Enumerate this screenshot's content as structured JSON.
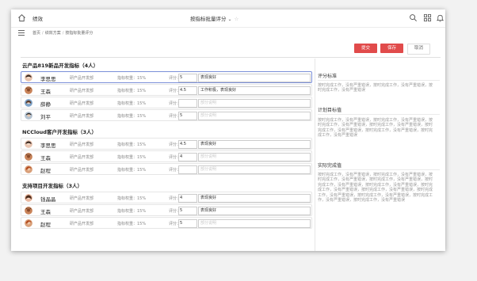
{
  "header": {
    "app_title": "绩效",
    "page_title": "按指标批量评分"
  },
  "breadcrumb": {
    "items": [
      "首页",
      "绩效方案",
      "按指标批量评分"
    ]
  },
  "actions": {
    "submit": "提交",
    "save": "保存",
    "cancel": "取消"
  },
  "groups": [
    {
      "title": "云产品819新品开发指标（4人）",
      "rows": [
        {
          "name": "李思思",
          "dept": "研产品开发部",
          "weight": "指标权重：15%",
          "score_label": "评分：",
          "score": "5",
          "comment": "表现良好",
          "comment_placeholder": ""
        },
        {
          "name": "王森",
          "dept": "研产品开发部",
          "weight": "指标权重：15%",
          "score_label": "评分：",
          "score": "4.5",
          "comment": "工作积极，表现良好",
          "comment_placeholder": ""
        },
        {
          "name": "薛静",
          "dept": "研产品开发部",
          "weight": "指标权重：15%",
          "score_label": "评分：",
          "score": "",
          "comment": "",
          "comment_placeholder": "部分说明"
        },
        {
          "name": "刘平",
          "dept": "研产品开发部",
          "weight": "指标权重：15%",
          "score_label": "评分：",
          "score": "5",
          "comment": "",
          "comment_placeholder": "部分说明"
        }
      ]
    },
    {
      "title": "NCCloud客户开发指标（3人）",
      "rows": [
        {
          "name": "李思思",
          "dept": "研产品开发部",
          "weight": "指标权重：15%",
          "score_label": "评分：",
          "score": "4.5",
          "comment": "表现良好",
          "comment_placeholder": ""
        },
        {
          "name": "王森",
          "dept": "研产品开发部",
          "weight": "指标权重：15%",
          "score_label": "评分：",
          "score": "4",
          "comment": "",
          "comment_placeholder": "部分说明"
        },
        {
          "name": "赵程",
          "dept": "研产品开发部",
          "weight": "指标权重：15%",
          "score_label": "评分：",
          "score": "",
          "comment": "",
          "comment_placeholder": "部分说明"
        }
      ]
    },
    {
      "title": "支持项目开发指标（3人）",
      "rows": [
        {
          "name": "钱晶晶",
          "dept": "研产品开发部",
          "weight": "指标权重：15%",
          "score_label": "评分：",
          "score": "4",
          "comment": "表现良好",
          "comment_placeholder": ""
        },
        {
          "name": "王森",
          "dept": "研产品开发部",
          "weight": "指标权重：15%",
          "score_label": "评分：",
          "score": "5",
          "comment": "表现良好",
          "comment_placeholder": ""
        },
        {
          "name": "赵程",
          "dept": "研产品开发部",
          "weight": "指标权重：15%",
          "score_label": "评分：",
          "score": "5",
          "comment": "",
          "comment_placeholder": "部分说明"
        }
      ]
    }
  ],
  "side": {
    "sections": [
      {
        "title": "评分标准",
        "body": "按时完成工作，没有严重错误，按时完成工作，没有严重错误，按时完成工作，没有严重错误"
      },
      {
        "title": "计划目标值",
        "body": "按时完成工作，没有严重错误，按时完成工作，没有严重错误，按时完成工作，没有严重错误，按时完成工作，没有严重错误，按时完成工作，没有严重错误，按时完成工作，没有严重错误，按时完成工作，没有严重错误"
      },
      {
        "title": "实际完成值",
        "body": "按时完成工作，没有严重错误，按时完成工作，没有严重错误，按时完成工作，没有严重错误，按时完成工作，没有严重错误，按时完成工作，没有严重错误，按时完成工作，没有严重错误，按时完成工作，没有严重错误，按时完成工作，没有严重错误，按时完成工作，没有严重错误，按时完成工作，没有严重错误，按时完成工作，没有严重错误，按时完成工作，没有严重错误"
      }
    ]
  },
  "colors": {
    "accent_red": "#e14b4b",
    "active_row_border": "#7b8fd8"
  }
}
